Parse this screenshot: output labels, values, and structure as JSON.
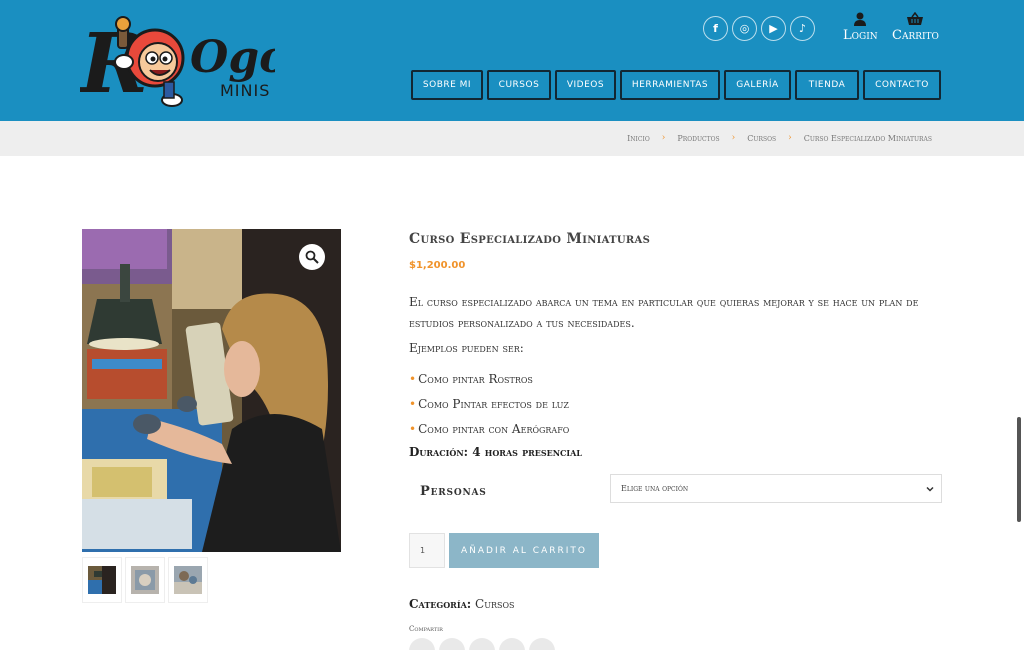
{
  "header": {
    "brand": {
      "logo_text": "Ogo",
      "logo_sub": "MINIS"
    },
    "socials": [
      {
        "name": "facebook-icon",
        "glyph": "f"
      },
      {
        "name": "instagram-icon",
        "glyph": "◎"
      },
      {
        "name": "youtube-icon",
        "glyph": "▶"
      },
      {
        "name": "tiktok-icon",
        "glyph": "♪"
      }
    ],
    "login_label": "Login",
    "cart_label": "Carrito",
    "nav": [
      {
        "label": "SOBRE MI"
      },
      {
        "label": "CURSOS"
      },
      {
        "label": "VIDEOS"
      },
      {
        "label": "HERRAMIENTAS"
      },
      {
        "label": "GALERÍA"
      },
      {
        "label": "TIENDA"
      },
      {
        "label": "CONTACTO"
      }
    ],
    "colors": {
      "bar": "#1a8fc1",
      "nav_border": "#122733"
    }
  },
  "breadcrumb": {
    "items": [
      "Inicio",
      "Productos",
      "Cursos",
      "Curso Especializado Miniaturas"
    ],
    "separator": "›"
  },
  "product": {
    "title": "Curso Especializado Miniaturas",
    "price": "$1,200.00",
    "description": "El curso especializado abarca un tema en particular que quieras mejorar y se hace un plan de estudios personalizado a tus necesidades.",
    "examples_intro": "Ejemplos pueden ser:",
    "bullet_glyph": "•",
    "examples": [
      "Como pintar Rostros",
      "Como Pintar efectos de luz",
      "Como pintar con Aerógrafo"
    ],
    "duration": "Duración: 4 horas presencial",
    "variation_label": "Personas",
    "variation_placeholder": "Elige una opción",
    "quantity": "1",
    "add_to_cart_label": "AÑADIR AL CARRITO",
    "category_label": "Categoría:",
    "category_value": "Cursos",
    "share_label": "Compartir",
    "accent_color": "#f0932b",
    "button_color": "#8cb6c8"
  }
}
